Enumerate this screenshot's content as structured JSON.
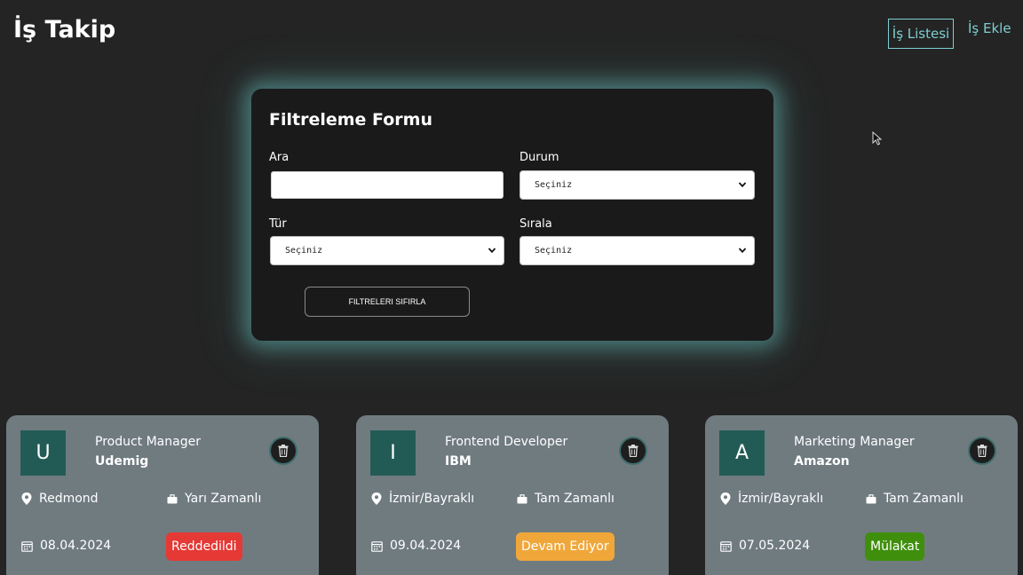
{
  "header": {
    "brand": "İş Takip",
    "nav": {
      "list_label": "İş Listesi",
      "add_label": "İş Ekle"
    }
  },
  "filter_form": {
    "title": "Filtreleme Formu",
    "search": {
      "label": "Ara",
      "value": "",
      "placeholder": ""
    },
    "status": {
      "label": "Durum",
      "selected": "Seçiniz"
    },
    "type": {
      "label": "Tür",
      "selected": "Seçiniz"
    },
    "sort": {
      "label": "Sırala",
      "selected": "Seçiniz"
    },
    "reset_label": "FILTRELERI SIFIRLA"
  },
  "jobs": [
    {
      "initial": "U",
      "position": "Product Manager",
      "company": "Udemig",
      "location": "Redmond",
      "type": "Yarı Zamanlı",
      "date": "08.04.2024",
      "status": "Reddedildi",
      "status_color": "#e53935"
    },
    {
      "initial": "I",
      "position": "Frontend Developer",
      "company": "IBM",
      "location": "İzmir/Bayraklı",
      "type": "Tam Zamanlı",
      "date": "09.04.2024",
      "status": "Devam Ediyor",
      "status_color": "#f0a73a"
    },
    {
      "initial": "A",
      "position": "Marketing Manager",
      "company": "Amazon",
      "location": "İzmir/Bayraklı",
      "type": "Tam Zamanlı",
      "date": "07.05.2024",
      "status": "Mülakat",
      "status_color": "#3f8f0c"
    }
  ],
  "colors": {
    "accent": "#7ecfd0",
    "background": "#242424",
    "card": "#707b80",
    "avatar": "#225b55"
  }
}
